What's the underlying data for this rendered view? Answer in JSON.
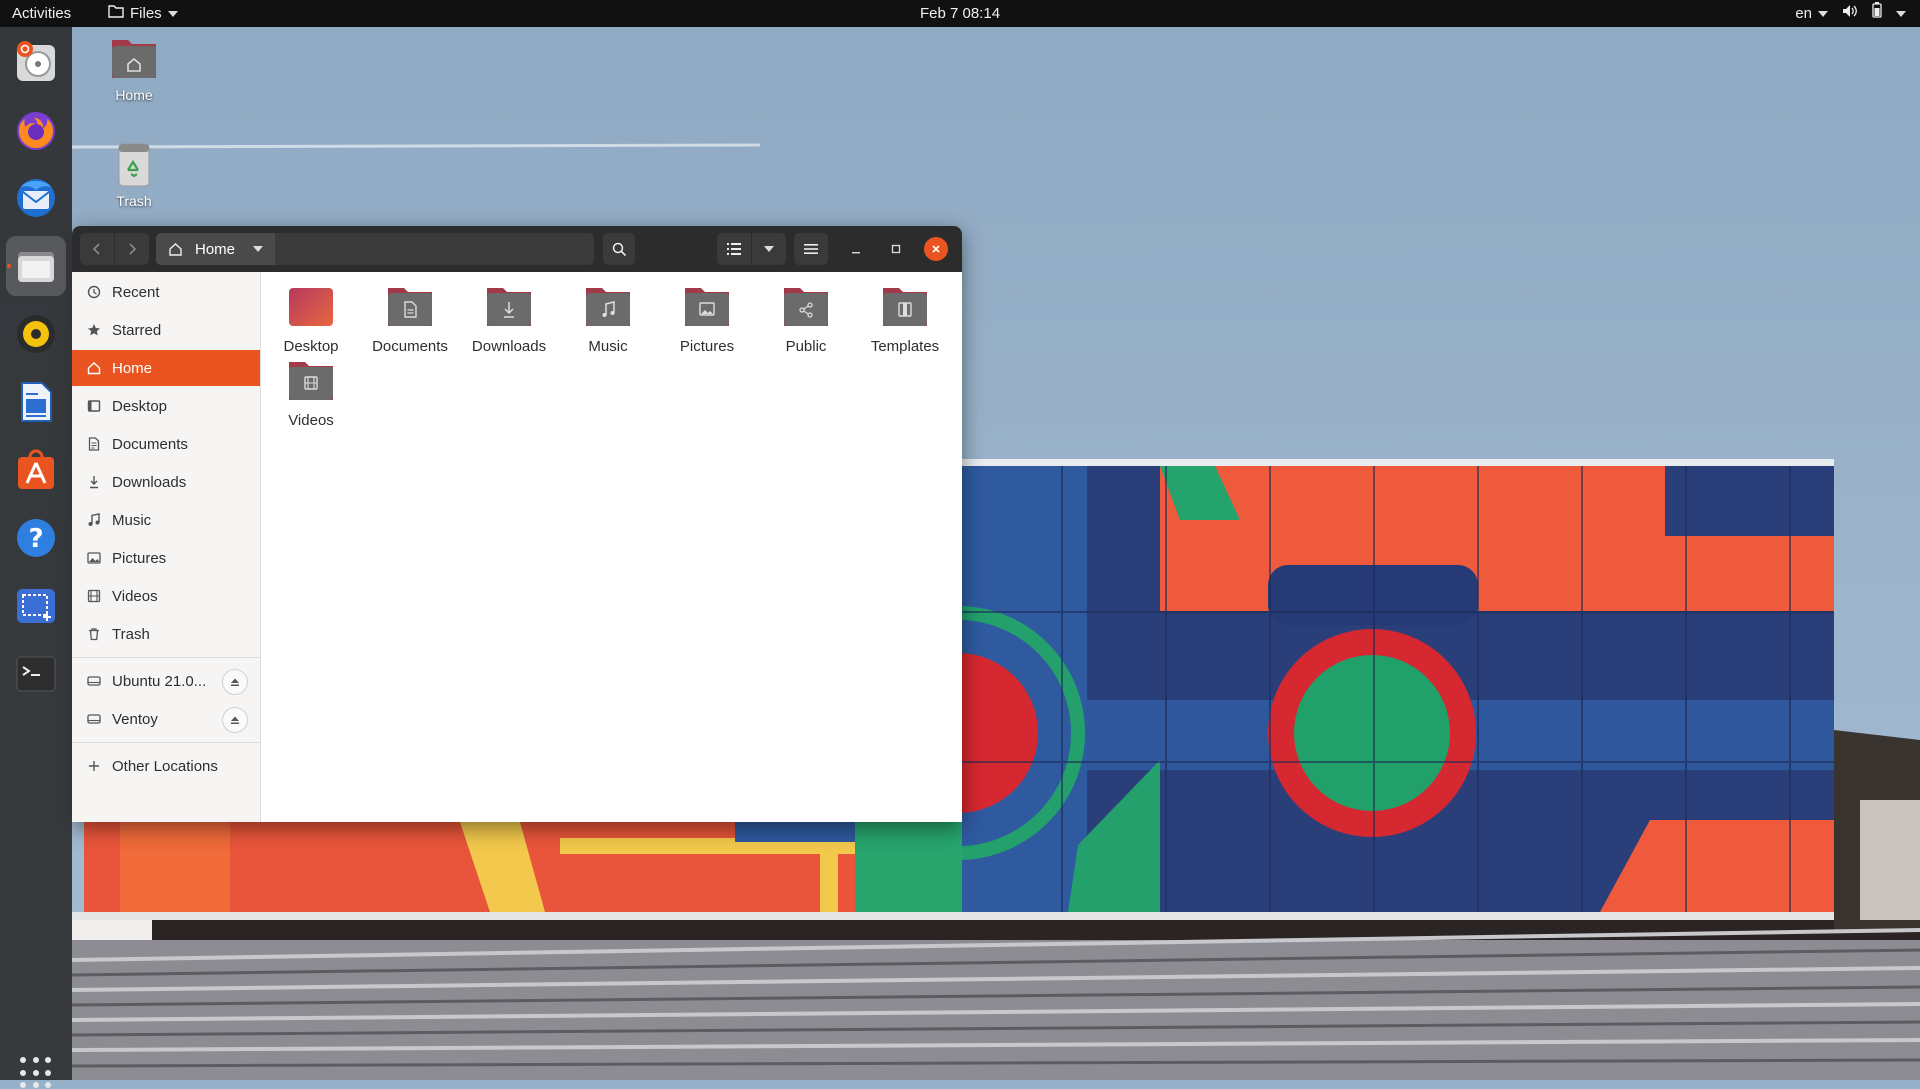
{
  "topbar": {
    "activities": "Activities",
    "app_menu": "Files",
    "clock": "Feb 7  08:14",
    "input_source": "en"
  },
  "dock": {
    "items": [
      {
        "name": "disk-installer",
        "icon": "ubuntu-installer-icon"
      },
      {
        "name": "firefox",
        "icon": "firefox-icon"
      },
      {
        "name": "thunderbird",
        "icon": "thunderbird-icon"
      },
      {
        "name": "files",
        "icon": "files-icon",
        "active": true
      },
      {
        "name": "rhythmbox",
        "icon": "rhythmbox-icon"
      },
      {
        "name": "writer",
        "icon": "libreoffice-writer-icon"
      },
      {
        "name": "software",
        "icon": "software-center-icon"
      },
      {
        "name": "help",
        "icon": "help-icon"
      },
      {
        "name": "screenshot",
        "icon": "screenshot-icon"
      },
      {
        "name": "terminal",
        "icon": "terminal-icon"
      }
    ],
    "show_apps_icon": "app-grid-icon"
  },
  "desktop": {
    "home_label": "Home",
    "trash_label": "Trash"
  },
  "window": {
    "path_segment": "Home",
    "sidebar": {
      "places": [
        {
          "label": "Recent",
          "icon": "clock-icon"
        },
        {
          "label": "Starred",
          "icon": "star-icon"
        },
        {
          "label": "Home",
          "icon": "home-icon",
          "active": true
        },
        {
          "label": "Desktop",
          "icon": "desktop-icon"
        },
        {
          "label": "Documents",
          "icon": "document-icon"
        },
        {
          "label": "Downloads",
          "icon": "download-icon"
        },
        {
          "label": "Music",
          "icon": "music-icon"
        },
        {
          "label": "Pictures",
          "icon": "picture-icon"
        },
        {
          "label": "Videos",
          "icon": "video-icon"
        },
        {
          "label": "Trash",
          "icon": "trash-icon"
        }
      ],
      "devices": [
        {
          "label": "Ubuntu 21.0...",
          "icon": "drive-icon"
        },
        {
          "label": "Ventoy",
          "icon": "drive-icon"
        }
      ],
      "other_locations": "Other Locations"
    },
    "folders": [
      {
        "label": "Desktop",
        "emblem": "none"
      },
      {
        "label": "Documents",
        "emblem": "document"
      },
      {
        "label": "Downloads",
        "emblem": "download"
      },
      {
        "label": "Music",
        "emblem": "music"
      },
      {
        "label": "Pictures",
        "emblem": "picture"
      },
      {
        "label": "Public",
        "emblem": "share"
      },
      {
        "label": "Templates",
        "emblem": "template"
      },
      {
        "label": "Videos",
        "emblem": "video"
      }
    ]
  },
  "colors": {
    "accent": "#e95420",
    "folder_tab": "#a33a4a",
    "folder_body": "#6b6b6b",
    "headerbar": "#2c2c2c",
    "sidebar_bg": "#f6f5f4"
  }
}
